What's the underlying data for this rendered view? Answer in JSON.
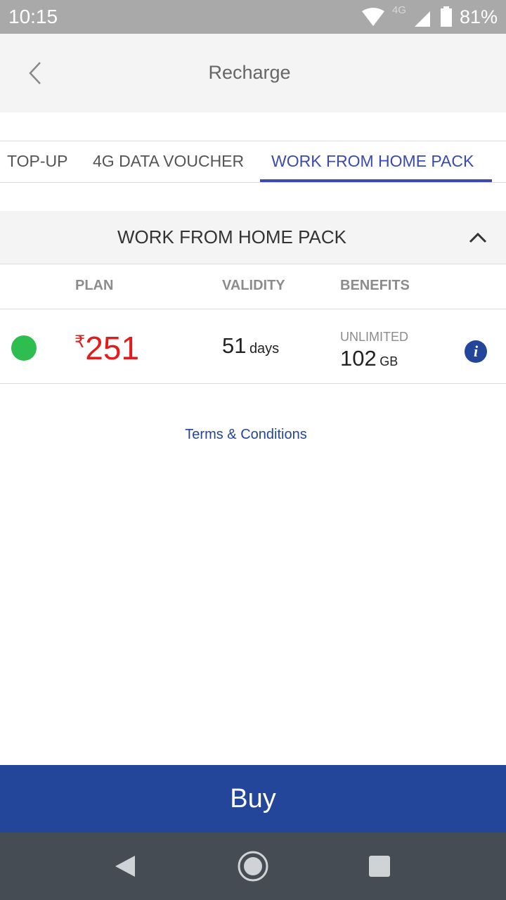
{
  "status_bar": {
    "time": "10:15",
    "network_type": "4G",
    "battery": "81%",
    "icons": [
      "wifi-icon",
      "signal-icon",
      "battery-icon"
    ]
  },
  "app_bar": {
    "title": "Recharge",
    "back_icon": "chevron-left-icon"
  },
  "tabs": [
    {
      "label": "TOP-UP",
      "active": false
    },
    {
      "label": "4G DATA VOUCHER",
      "active": false
    },
    {
      "label": "WORK FROM HOME PACK",
      "active": true
    }
  ],
  "pack": {
    "title": "WORK FROM HOME PACK",
    "expanded": true,
    "toggle_icon": "chevron-up-icon"
  },
  "columns": {
    "plan": "PLAN",
    "validity": "VALIDITY",
    "benefits": "BENEFITS"
  },
  "plan": {
    "selected": true,
    "currency_symbol": "₹",
    "price": "251",
    "validity_value": "51",
    "validity_unit": "days",
    "benefit_label": "UNLIMITED",
    "benefit_value": "102",
    "benefit_unit": "GB",
    "info_icon": "info-icon",
    "info_glyph": "i"
  },
  "terms_label": "Terms & Conditions",
  "buy_label": "Buy",
  "nav_bar": {
    "icons": [
      "back-icon",
      "home-icon",
      "recents-icon"
    ]
  },
  "colors": {
    "accent": "#3b4ab0",
    "primary_blue": "#23469a",
    "price_red": "#e31b1b",
    "selected_green": "#2dbe4f"
  }
}
